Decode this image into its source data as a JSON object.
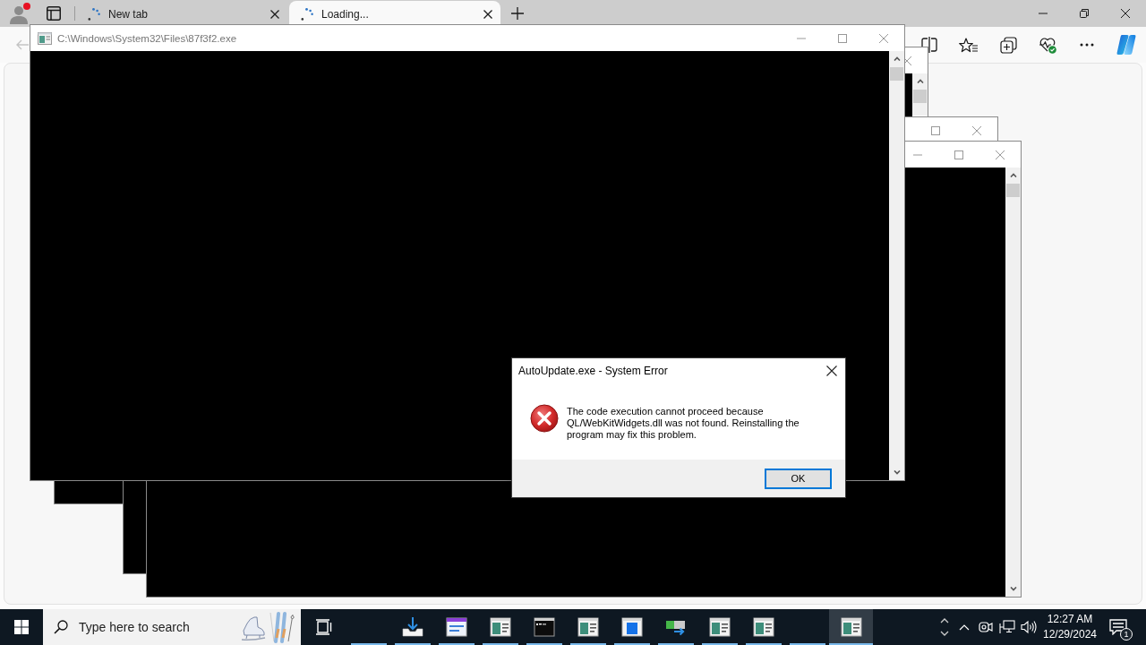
{
  "browser": {
    "tabs": [
      {
        "title": "New tab",
        "loading": true,
        "selected": false
      },
      {
        "title": "Loading...",
        "loading": true,
        "selected": true
      }
    ],
    "back_button": {
      "disabled": true
    }
  },
  "console_window": {
    "title": "C:\\Windows\\System32\\Files\\87f3f2.exe"
  },
  "dialog": {
    "kind": "error",
    "title": "AutoUpdate.exe - System Error",
    "message": "The code execution cannot proceed because QL/WebKitWidgets.dll was not found. Reinstalling the program may fix this problem.",
    "buttons": [
      "OK"
    ]
  },
  "taskbar": {
    "search": {
      "placeholder": "Type here to search"
    },
    "apps": [
      {
        "kind": "blank",
        "running": true,
        "selected": false
      },
      {
        "kind": "download",
        "running": true,
        "selected": false
      },
      {
        "kind": "dialog",
        "running": true,
        "selected": false
      },
      {
        "kind": "program",
        "running": true,
        "selected": false
      },
      {
        "kind": "console",
        "running": true,
        "selected": false
      },
      {
        "kind": "program",
        "running": true,
        "selected": false
      },
      {
        "kind": "program-blue",
        "running": true,
        "selected": false
      },
      {
        "kind": "transfer",
        "running": true,
        "selected": false
      },
      {
        "kind": "program",
        "running": true,
        "selected": false
      },
      {
        "kind": "program",
        "running": true,
        "selected": false
      },
      {
        "kind": "blank",
        "running": true,
        "selected": false
      },
      {
        "kind": "program",
        "running": true,
        "selected": true
      }
    ],
    "clock": {
      "time": "12:27 AM",
      "date": "12/29/2024"
    },
    "notification_count": "1"
  }
}
